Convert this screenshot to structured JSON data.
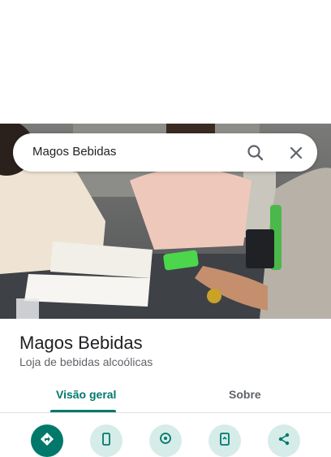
{
  "search": {
    "query": "Magos Bebidas",
    "search_icon": "search-icon",
    "close_icon": "close-icon"
  },
  "place": {
    "name": "Magos Bebidas",
    "category": "Loja de bebidas alcoólicas"
  },
  "tabs": [
    {
      "label": "Visão geral",
      "active": true
    },
    {
      "label": "Sobre",
      "active": false
    }
  ],
  "actions": [
    {
      "icon": "directions-icon"
    },
    {
      "icon": "phone-icon"
    },
    {
      "icon": "location-icon"
    },
    {
      "icon": "send-to-phone-icon"
    },
    {
      "icon": "share-icon"
    }
  ],
  "colors": {
    "accent": "#00796b",
    "action_bg": "#d5ece9",
    "title": "#202124",
    "muted": "#5f6368"
  }
}
